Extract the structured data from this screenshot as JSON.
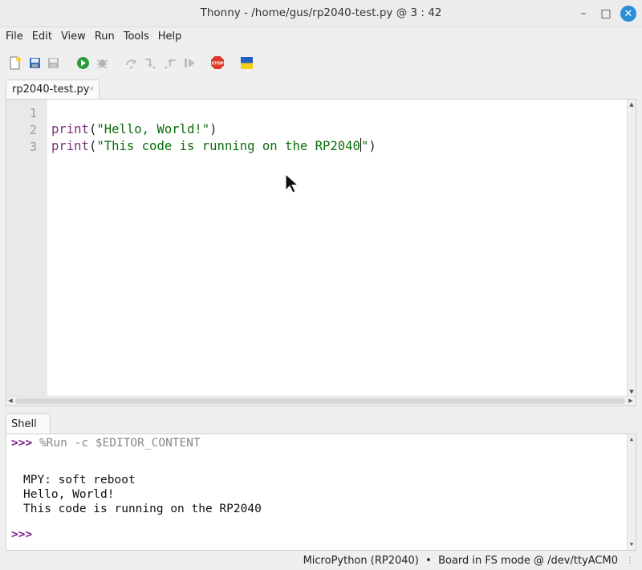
{
  "window": {
    "title": "Thonny  -  /home/gus/rp2040-test.py  @  3 : 42",
    "minimize_glyph": "–",
    "maximize_glyph": "□",
    "close_glyph": "✕"
  },
  "menubar": [
    "File",
    "Edit",
    "View",
    "Run",
    "Tools",
    "Help"
  ],
  "toolbar": {
    "icons": [
      "new-file-icon",
      "open-file-icon",
      "save-file-icon",
      "run-icon",
      "debug-icon",
      "step-over-icon",
      "step-into-icon",
      "step-out-icon",
      "resume-icon",
      "stop-icon",
      "ukraine-flag-icon"
    ],
    "stop_label": "STOP"
  },
  "editor": {
    "tab_label": "rp2040-test.py",
    "tab_close": "×",
    "line_numbers": [
      "1",
      "2",
      "3"
    ],
    "lines": [
      {
        "kw": "",
        "open": "",
        "str_a": "",
        "str_b": "",
        "close": ""
      },
      {
        "kw": "print",
        "open": "(",
        "str_a": "\"Hello, World!\"",
        "str_b": "",
        "close": ")"
      },
      {
        "kw": "print",
        "open": "(",
        "str_a": "\"This code is running on the RP2040",
        "str_b": "\"",
        "close": ")"
      }
    ],
    "cursor_line": 3,
    "cursor_after": "\"This code is running on the RP2040"
  },
  "shell": {
    "tab_label": "Shell",
    "prompt": ">>>",
    "command": "%Run -c $EDITOR_CONTENT",
    "output": [
      "MPY: soft reboot",
      "Hello, World!",
      "This code is running on the RP2040"
    ]
  },
  "statusbar": {
    "interpreter": "MicroPython (RP2040)",
    "separator": "•",
    "board": "Board in FS mode @ /dev/ttyACM0"
  },
  "colors": {
    "keyword": "#7a2f7a",
    "string": "#0b6e0b",
    "prompt": "#7a1f8a",
    "close_button": "#2a8fd8",
    "stop": "#d93a2a",
    "flag_blue": "#1f5fc6",
    "flag_yellow": "#f5cf16"
  }
}
